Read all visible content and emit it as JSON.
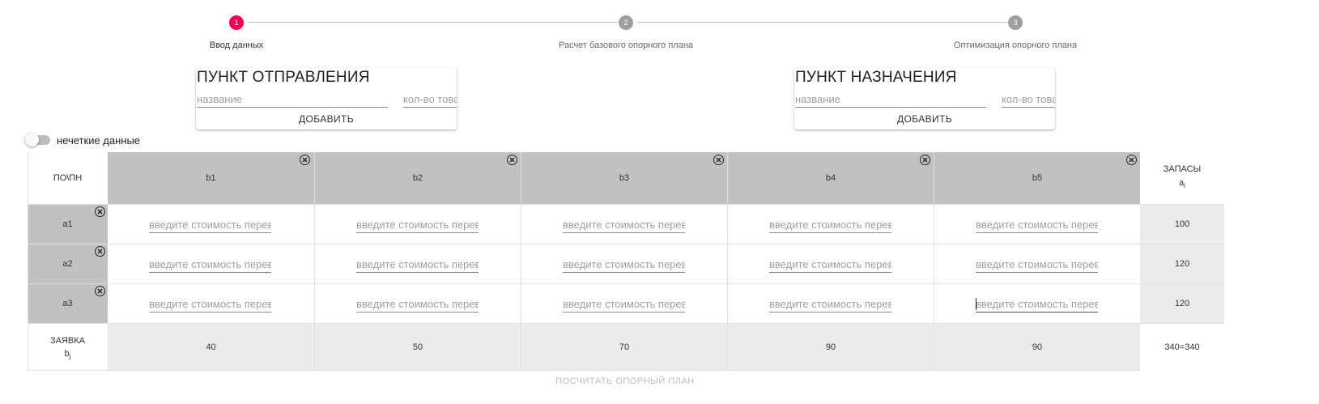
{
  "stepper": {
    "steps": [
      {
        "number": "1",
        "label": "Ввод данных",
        "active": true
      },
      {
        "number": "2",
        "label": "Расчет базового опорного плана",
        "active": false
      },
      {
        "number": "3",
        "label": "Оптимизация опорного плана",
        "active": false
      }
    ]
  },
  "departure_card": {
    "title": "ПУНКТ ОТПРАВЛЕНИЯ",
    "name_placeholder": "название",
    "qty_placeholder": "кол-во товара",
    "add_label": "ДОБАВИТЬ"
  },
  "destination_card": {
    "title": "ПУНКТ НАЗНАЧЕНИЯ",
    "name_placeholder": "название",
    "qty_placeholder": "кол-во товара",
    "add_label": "ДОБАВИТЬ"
  },
  "fuzzy_toggle": {
    "label": "нечеткие данные",
    "on": false
  },
  "table": {
    "corner_label": "ПО\\ПН",
    "supply_header": "ЗАПАСЫ",
    "supply_symbol": "a",
    "supply_subscript": "i",
    "demand_label": "ЗАЯВКА",
    "demand_symbol": "b",
    "demand_subscript": "j",
    "columns": [
      "b1",
      "b2",
      "b3",
      "b4",
      "b5"
    ],
    "rows": [
      "a1",
      "a2",
      "a3"
    ],
    "cost_placeholder": "введите стоимость перевозки",
    "supplies": [
      "100",
      "120",
      "120"
    ],
    "demands": [
      "40",
      "50",
      "70",
      "90",
      "90"
    ],
    "balance": "340=340"
  },
  "calc_button_label": "ПОСЧИТАТЬ ОПОРНЫЙ ПЛАН",
  "colors": {
    "accent": "#f50057",
    "step_inactive": "#9e9e9e",
    "header_dark": "#c1c1c1",
    "header_light": "#ebebeb",
    "focus": "#3f51b5"
  }
}
